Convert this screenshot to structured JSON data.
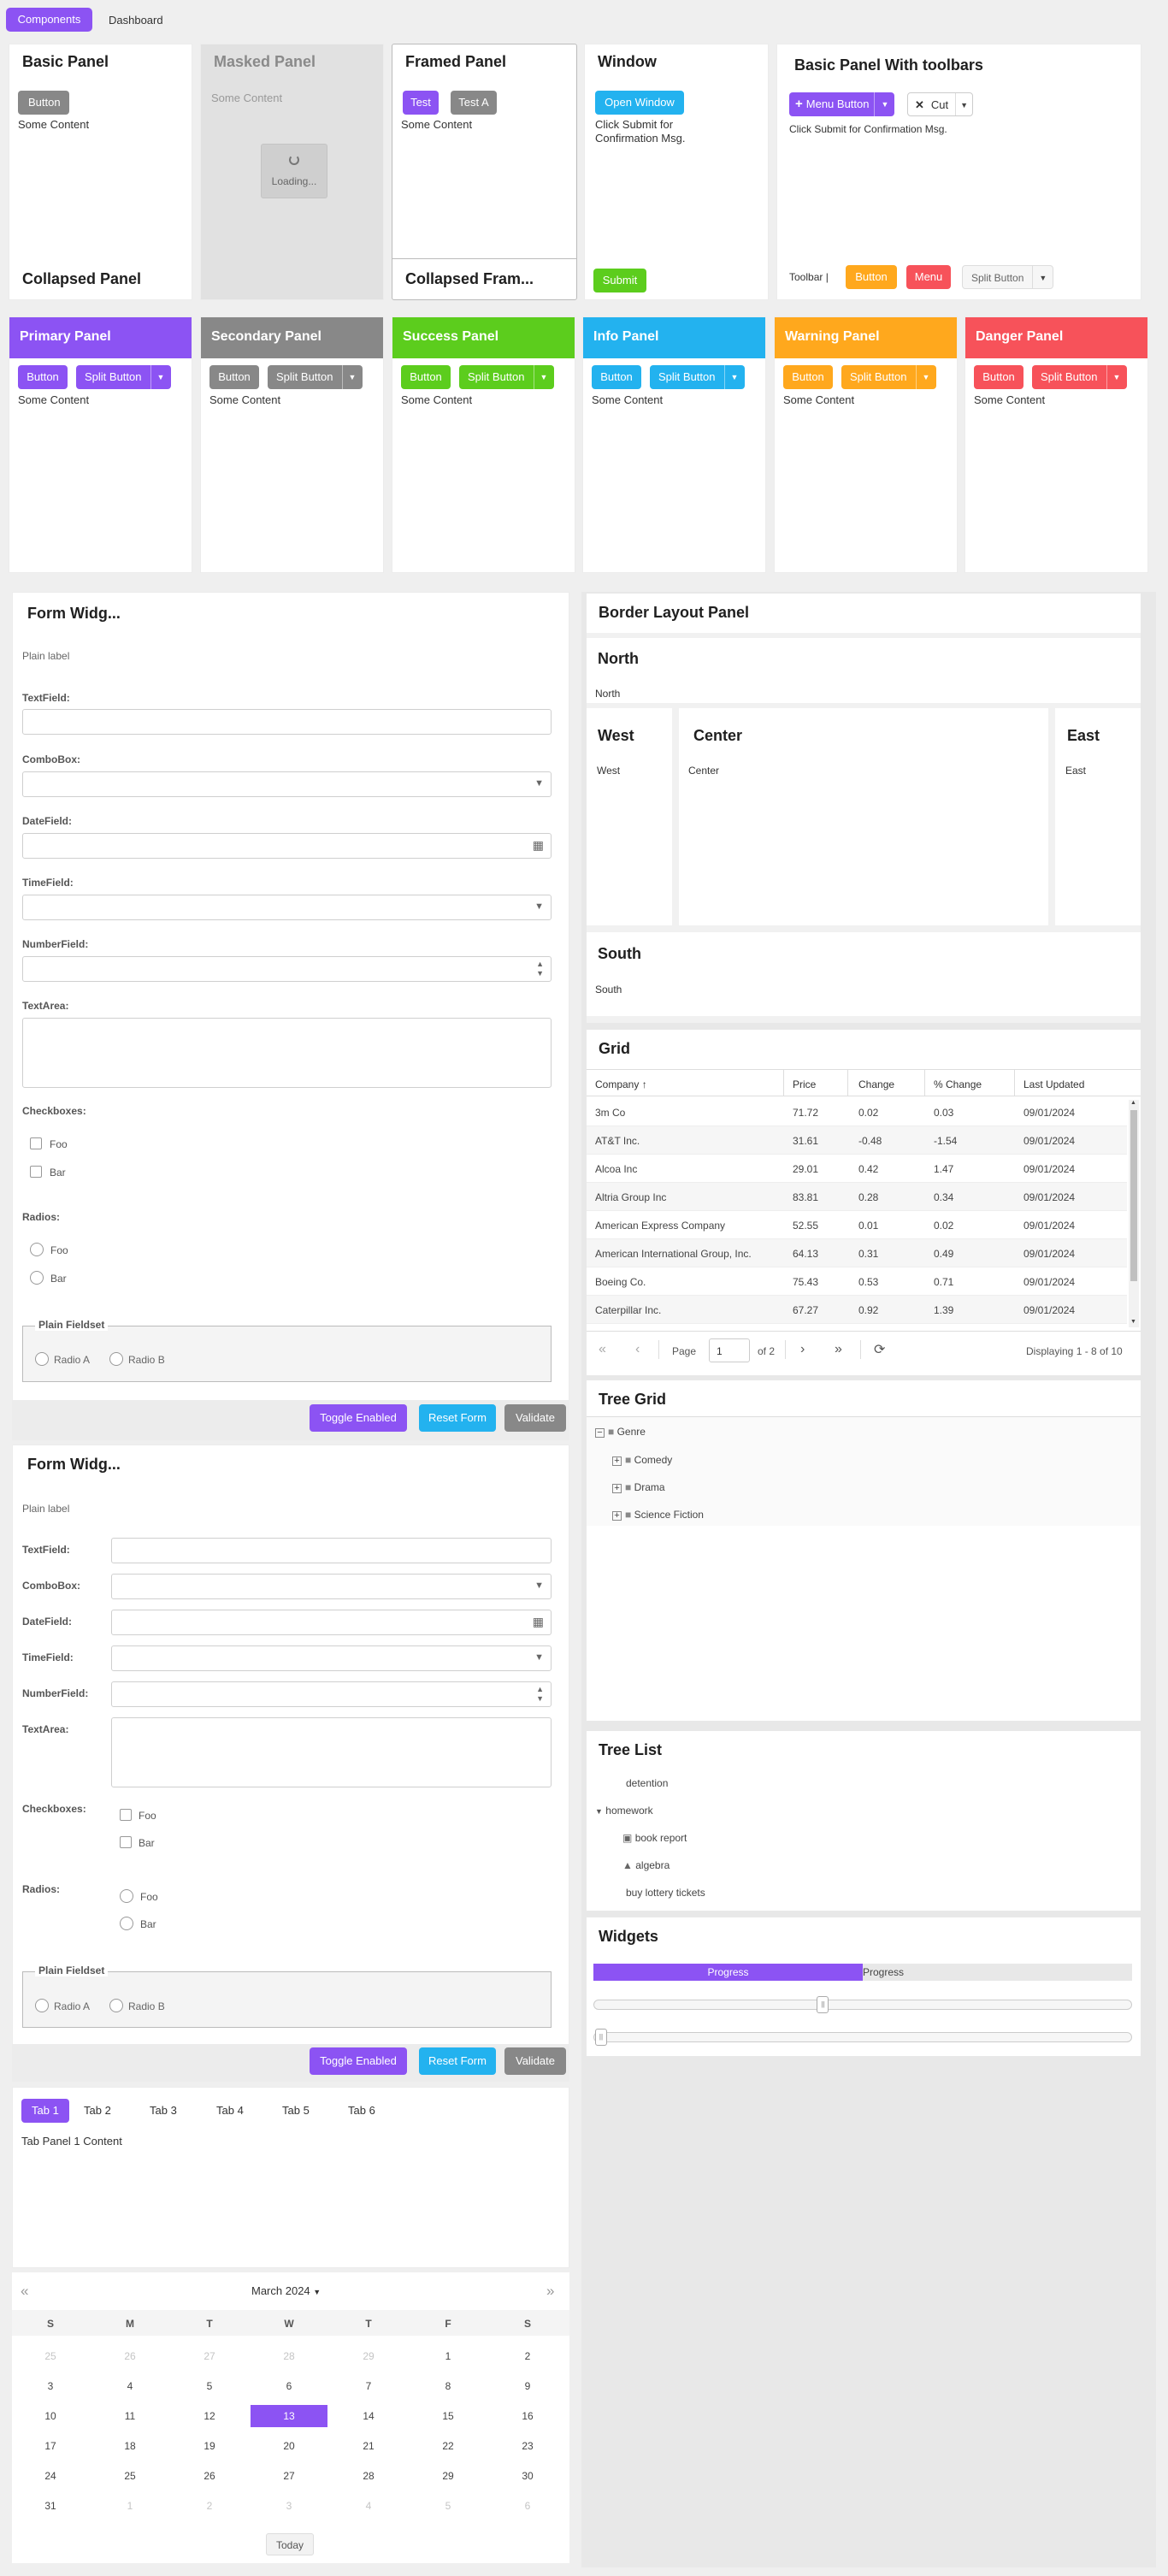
{
  "topnav": {
    "components": "Components",
    "dashboard": "Dashboard"
  },
  "basic_panel": {
    "title": "Basic Panel",
    "button": "Button",
    "content": "Some Content",
    "collapsed": "Collapsed Panel"
  },
  "masked_panel": {
    "title": "Masked Panel",
    "content": "Some Content",
    "loading": "Loading..."
  },
  "framed_panel": {
    "title": "Framed Panel",
    "test": "Test",
    "test_a": "Test A",
    "content": "Some Content",
    "collapsed": "Collapsed Fram..."
  },
  "window_panel": {
    "title": "Window",
    "open": "Open Window",
    "msg": "Click Submit for Confirmation Msg.",
    "submit": "Submit"
  },
  "toolbar_panel": {
    "title": "Basic Panel With toolbars",
    "menu_button": "Menu Button",
    "cut": "Cut",
    "msg": "Click Submit for Confirmation Msg.",
    "toolbar_label": "Toolbar |",
    "button": "Button",
    "menu": "Menu",
    "split_button": "Split Button"
  },
  "colored_panels": [
    {
      "title": "Primary Panel",
      "button": "Button",
      "split": "Split Button",
      "content": "Some Content",
      "color": "#8c53f3"
    },
    {
      "title": "Secondary Panel",
      "button": "Button",
      "split": "Split Button",
      "content": "Some Content",
      "color": "#888888"
    },
    {
      "title": "Success Panel",
      "button": "Button",
      "split": "Split Button",
      "content": "Some Content",
      "color": "#5ccd1d"
    },
    {
      "title": "Info Panel",
      "button": "Button",
      "split": "Split Button",
      "content": "Some Content",
      "color": "#23b2ef"
    },
    {
      "title": "Warning Panel",
      "button": "Button",
      "split": "Split Button",
      "content": "Some Content",
      "color": "#ffa81d"
    },
    {
      "title": "Danger Panel",
      "button": "Button",
      "split": "Split Button",
      "content": "Some Content",
      "color": "#f7525a"
    }
  ],
  "form": {
    "title": "Form Widg...",
    "plain_label": "Plain label",
    "textfield": "TextField:",
    "combobox": "ComboBox:",
    "datefield": "DateField:",
    "timefield": "TimeField:",
    "numberfield": "NumberField:",
    "textarea": "TextArea:",
    "checkboxes": "Checkboxes:",
    "foo": "Foo",
    "bar": "Bar",
    "radios": "Radios:",
    "fieldset": "Plain Fieldset",
    "radio_a": "Radio A",
    "radio_b": "Radio B",
    "toggle": "Toggle Enabled",
    "reset": "Reset Form",
    "validate": "Validate"
  },
  "tabs": {
    "items": [
      "Tab 1",
      "Tab 2",
      "Tab 3",
      "Tab 4",
      "Tab 5",
      "Tab 6"
    ],
    "content": "Tab Panel 1 Content"
  },
  "calendar": {
    "month": "March 2024",
    "days": [
      "S",
      "M",
      "T",
      "W",
      "T",
      "F",
      "S"
    ],
    "weeks": [
      [
        "25",
        "26",
        "27",
        "28",
        "29",
        "1",
        "2"
      ],
      [
        "3",
        "4",
        "5",
        "6",
        "7",
        "8",
        "9"
      ],
      [
        "10",
        "11",
        "12",
        "13",
        "14",
        "15",
        "16"
      ],
      [
        "17",
        "18",
        "19",
        "20",
        "21",
        "22",
        "23"
      ],
      [
        "24",
        "25",
        "26",
        "27",
        "28",
        "29",
        "30"
      ],
      [
        "31",
        "1",
        "2",
        "3",
        "4",
        "5",
        "6"
      ]
    ],
    "today": "Today"
  },
  "border_layout": {
    "title": "Border Layout Panel",
    "north": "North",
    "north_body": "North",
    "west": "West",
    "west_body": "West",
    "center": "Center",
    "center_body": "Center",
    "east": "East",
    "east_body": "East",
    "south": "South",
    "south_body": "South"
  },
  "grid": {
    "title": "Grid",
    "columns": [
      "Company",
      "Price",
      "Change",
      "% Change",
      "Last Updated"
    ],
    "rows": [
      [
        "3m Co",
        "71.72",
        "0.02",
        "0.03",
        "09/01/2024"
      ],
      [
        "AT&T Inc.",
        "31.61",
        "-0.48",
        "-1.54",
        "09/01/2024"
      ],
      [
        "Alcoa Inc",
        "29.01",
        "0.42",
        "1.47",
        "09/01/2024"
      ],
      [
        "Altria Group Inc",
        "83.81",
        "0.28",
        "0.34",
        "09/01/2024"
      ],
      [
        "American Express Company",
        "52.55",
        "0.01",
        "0.02",
        "09/01/2024"
      ],
      [
        "American International Group, Inc.",
        "64.13",
        "0.31",
        "0.49",
        "09/01/2024"
      ],
      [
        "Boeing Co.",
        "75.43",
        "0.53",
        "0.71",
        "09/01/2024"
      ],
      [
        "Caterpillar Inc.",
        "67.27",
        "0.92",
        "1.39",
        "09/01/2024"
      ]
    ],
    "page_label": "Page",
    "page_value": "1",
    "of_pages": "of 2",
    "displaying": "Displaying 1 - 8 of 10"
  },
  "tree_grid": {
    "title": "Tree Grid",
    "root": "Genre",
    "children": [
      "Comedy",
      "Drama",
      "Science Fiction"
    ]
  },
  "tree_list": {
    "title": "Tree List",
    "items": [
      "detention",
      "homework",
      "book report",
      "algebra",
      "buy lottery tickets"
    ]
  },
  "widgets": {
    "title": "Widgets",
    "progress_left": "Progress",
    "progress_right": "Progress",
    "progress_fraction": 0.5
  }
}
